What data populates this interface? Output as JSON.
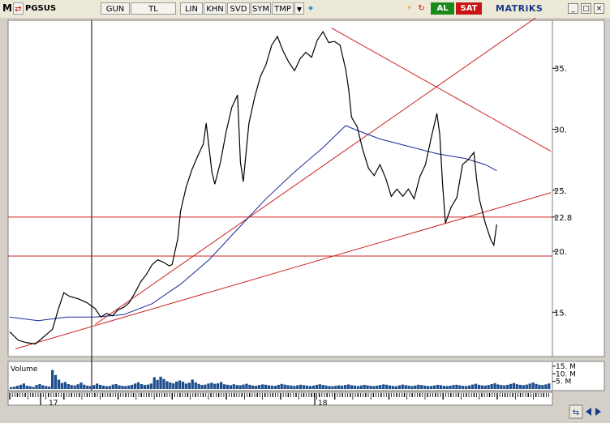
{
  "toolbar": {
    "menu_label": "M",
    "symbol": "PGSUS",
    "period": "GUN",
    "currency": "TL",
    "scale": "LIN",
    "khn": "KHN",
    "svd": "SVD",
    "sym": "SYM",
    "tmp": "TMP",
    "buy_label": "AL",
    "sell_label": "SAT",
    "brand": "MATRiKS",
    "colors": {
      "buy": "#1a8a1a",
      "sell": "#c81414",
      "brand": "#1a3a8a"
    }
  },
  "chart_data": {
    "type": "line",
    "symbol": "PGSUS",
    "y_scale": "linear",
    "ylim": [
      11.5,
      38.8
    ],
    "yticks": [
      15,
      20,
      25,
      30,
      35
    ],
    "ytick_labels": [
      "15.",
      "20.",
      "25.",
      "30.",
      "35."
    ],
    "price_level_label": "22.8",
    "x_labels": [
      "17",
      "18"
    ],
    "price": [
      [
        0,
        13.4
      ],
      [
        3,
        12.7
      ],
      [
        6,
        12.5
      ],
      [
        9,
        12.4
      ],
      [
        12,
        13.0
      ],
      [
        15,
        13.6
      ],
      [
        17,
        15.2
      ],
      [
        19,
        16.6
      ],
      [
        21,
        16.3
      ],
      [
        24,
        16.1
      ],
      [
        27,
        15.8
      ],
      [
        30,
        15.3
      ],
      [
        32,
        14.6
      ],
      [
        34,
        14.9
      ],
      [
        36,
        14.7
      ],
      [
        38,
        15.2
      ],
      [
        40,
        15.4
      ],
      [
        42,
        15.8
      ],
      [
        44,
        16.6
      ],
      [
        46,
        17.5
      ],
      [
        48,
        18.1
      ],
      [
        50,
        18.9
      ],
      [
        52,
        19.3
      ],
      [
        54,
        19.1
      ],
      [
        56,
        18.8
      ],
      [
        57,
        18.9
      ],
      [
        59,
        21.0
      ],
      [
        60,
        23.3
      ],
      [
        62,
        25.3
      ],
      [
        64,
        26.7
      ],
      [
        66,
        27.8
      ],
      [
        68,
        28.8
      ],
      [
        69,
        30.5
      ],
      [
        71,
        26.5
      ],
      [
        72,
        25.5
      ],
      [
        74,
        27.3
      ],
      [
        76,
        29.8
      ],
      [
        78,
        31.8
      ],
      [
        80,
        32.8
      ],
      [
        81,
        27.3
      ],
      [
        82,
        25.7
      ],
      [
        84,
        30.5
      ],
      [
        86,
        32.6
      ],
      [
        88,
        34.3
      ],
      [
        90,
        35.3
      ],
      [
        92,
        36.9
      ],
      [
        94,
        37.6
      ],
      [
        96,
        36.4
      ],
      [
        98,
        35.5
      ],
      [
        100,
        34.8
      ],
      [
        102,
        35.8
      ],
      [
        104,
        36.3
      ],
      [
        106,
        35.9
      ],
      [
        108,
        37.3
      ],
      [
        110,
        38.0
      ],
      [
        112,
        37.1
      ],
      [
        114,
        37.2
      ],
      [
        116,
        36.9
      ],
      [
        118,
        34.9
      ],
      [
        119,
        33.3
      ],
      [
        120,
        31.0
      ],
      [
        122,
        30.2
      ],
      [
        124,
        28.3
      ],
      [
        126,
        26.8
      ],
      [
        128,
        26.2
      ],
      [
        130,
        27.1
      ],
      [
        132,
        26.0
      ],
      [
        134,
        24.5
      ],
      [
        136,
        25.1
      ],
      [
        138,
        24.5
      ],
      [
        140,
        25.1
      ],
      [
        142,
        24.3
      ],
      [
        144,
        26.1
      ],
      [
        146,
        27.1
      ],
      [
        148,
        29.3
      ],
      [
        150,
        31.3
      ],
      [
        151,
        29.6
      ],
      [
        152,
        25.5
      ],
      [
        153,
        22.3
      ],
      [
        155,
        23.6
      ],
      [
        157,
        24.4
      ],
      [
        159,
        27.1
      ],
      [
        161,
        27.5
      ],
      [
        163,
        28.1
      ],
      [
        164,
        25.8
      ],
      [
        165,
        24.2
      ],
      [
        167,
        22.3
      ],
      [
        169,
        20.9
      ],
      [
        170,
        20.5
      ],
      [
        171,
        22.2
      ]
    ],
    "moving_average": [
      [
        0,
        14.6
      ],
      [
        10,
        14.3
      ],
      [
        20,
        14.6
      ],
      [
        30,
        14.6
      ],
      [
        40,
        14.8
      ],
      [
        50,
        15.7
      ],
      [
        60,
        17.3
      ],
      [
        70,
        19.3
      ],
      [
        80,
        21.8
      ],
      [
        90,
        24.3
      ],
      [
        100,
        26.5
      ],
      [
        110,
        28.5
      ],
      [
        118,
        30.3
      ],
      [
        121,
        30.0
      ],
      [
        130,
        29.2
      ],
      [
        140,
        28.6
      ],
      [
        150,
        28.0
      ],
      [
        160,
        27.6
      ],
      [
        167,
        27.1
      ],
      [
        171,
        26.6
      ]
    ],
    "trendlines": [
      {
        "from": [
          2,
          12.0
        ],
        "to": [
          190,
          24.8
        ]
      },
      {
        "from": [
          30,
          14.0
        ],
        "to": [
          190,
          40.0
        ]
      },
      {
        "from": [
          113,
          38.3
        ],
        "to": [
          190,
          28.2
        ]
      }
    ],
    "horizontal_lines": [
      22.8,
      19.6
    ],
    "volume": {
      "label": "Volume",
      "tick_labels": [
        "15. M",
        "10. M",
        "5. M"
      ],
      "max": 16,
      "values": [
        1.2,
        1.5,
        2.1,
        2.8,
        3.6,
        2.2,
        1.8,
        1.4,
        2.6,
        3.2,
        2.4,
        1.9,
        1.6,
        12.5,
        9.2,
        6.1,
        3.9,
        4.6,
        3.2,
        2.6,
        2.3,
        3.1,
        4.2,
        2.8,
        2.2,
        1.9,
        2.5,
        3.5,
        2.7,
        2.2,
        1.8,
        2.0,
        2.9,
        3.2,
        2.4,
        2.1,
        1.9,
        2.3,
        2.8,
        3.6,
        4.4,
        3.2,
        2.6,
        2.9,
        3.6,
        7.8,
        5.9,
        8.1,
        6.6,
        5.1,
        4.3,
        3.7,
        4.9,
        5.6,
        4.8,
        3.5,
        4.1,
        6.2,
        4.4,
        3.3,
        2.6,
        2.9,
        3.6,
        4.1,
        3.4,
        3.7,
        4.6,
        3.1,
        2.8,
        2.5,
        3.1,
        2.6,
        2.4,
        2.9,
        3.4,
        2.7,
        2.3,
        2.1,
        2.6,
        3.0,
        2.8,
        2.4,
        2.2,
        2.1,
        2.7,
        3.3,
        2.9,
        2.5,
        2.3,
        2.0,
        2.4,
        2.8,
        2.5,
        2.2,
        1.9,
        2.2,
        2.7,
        3.1,
        2.6,
        2.3,
        2.0,
        1.8,
        2.1,
        2.4,
        2.2,
        2.6,
        3.0,
        2.5,
        2.2,
        1.9,
        2.3,
        2.7,
        2.4,
        2.1,
        1.9,
        2.2,
        2.6,
        3.0,
        2.8,
        2.3,
        2.0,
        1.8,
        2.4,
        2.9,
        2.5,
        2.2,
        2.0,
        2.3,
        2.8,
        2.6,
        2.2,
        2.0,
        1.9,
        2.3,
        2.7,
        2.5,
        2.1,
        1.9,
        2.2,
        2.6,
        2.8,
        2.4,
        2.1,
        2.0,
        2.3,
        2.9,
        3.4,
        2.8,
        2.4,
        2.2,
        2.6,
        3.2,
        3.8,
        3.0,
        2.6,
        2.4,
        2.8,
        3.3,
        3.9,
        3.1,
        2.7,
        2.5,
        2.9,
        3.5,
        4.2,
        3.3,
        2.8,
        2.6,
        3.0,
        3.6
      ]
    }
  }
}
